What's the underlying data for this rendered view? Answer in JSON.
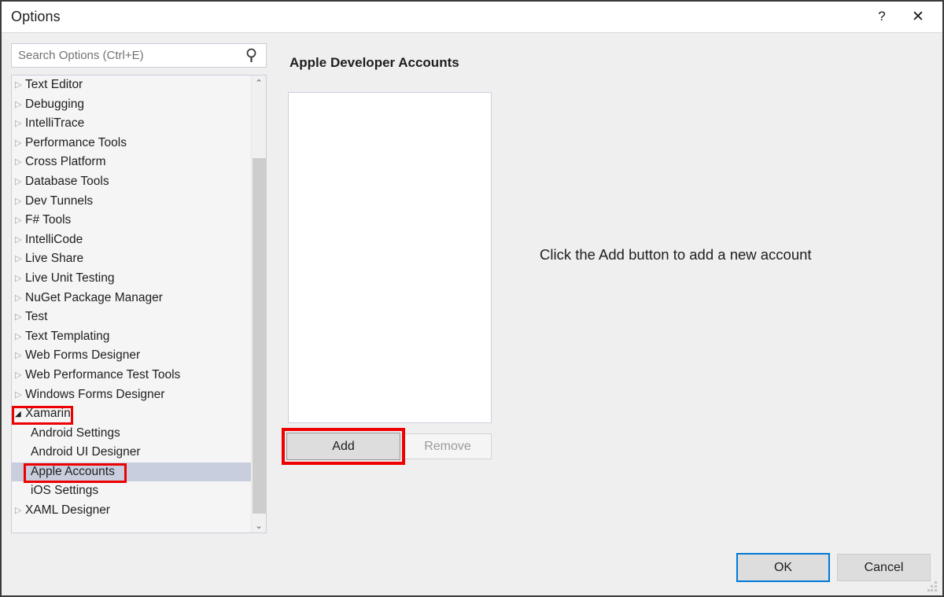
{
  "window": {
    "title": "Options",
    "help_label": "?",
    "close_label": "✕"
  },
  "search": {
    "placeholder": "Search Options (Ctrl+E)",
    "value": "",
    "icon": "search-icon"
  },
  "tree": {
    "items": [
      {
        "label": "Text Editor",
        "state": "collapsed",
        "level": 0,
        "selected": false
      },
      {
        "label": "Debugging",
        "state": "collapsed",
        "level": 0,
        "selected": false
      },
      {
        "label": "IntelliTrace",
        "state": "collapsed",
        "level": 0,
        "selected": false
      },
      {
        "label": "Performance Tools",
        "state": "collapsed",
        "level": 0,
        "selected": false
      },
      {
        "label": "Cross Platform",
        "state": "collapsed",
        "level": 0,
        "selected": false
      },
      {
        "label": "Database Tools",
        "state": "collapsed",
        "level": 0,
        "selected": false
      },
      {
        "label": "Dev Tunnels",
        "state": "collapsed",
        "level": 0,
        "selected": false
      },
      {
        "label": "F# Tools",
        "state": "collapsed",
        "level": 0,
        "selected": false
      },
      {
        "label": "IntelliCode",
        "state": "collapsed",
        "level": 0,
        "selected": false
      },
      {
        "label": "Live Share",
        "state": "collapsed",
        "level": 0,
        "selected": false
      },
      {
        "label": "Live Unit Testing",
        "state": "collapsed",
        "level": 0,
        "selected": false
      },
      {
        "label": "NuGet Package Manager",
        "state": "collapsed",
        "level": 0,
        "selected": false
      },
      {
        "label": "Test",
        "state": "collapsed",
        "level": 0,
        "selected": false
      },
      {
        "label": "Text Templating",
        "state": "collapsed",
        "level": 0,
        "selected": false
      },
      {
        "label": "Web Forms Designer",
        "state": "collapsed",
        "level": 0,
        "selected": false
      },
      {
        "label": "Web Performance Test Tools",
        "state": "collapsed",
        "level": 0,
        "selected": false
      },
      {
        "label": "Windows Forms Designer",
        "state": "collapsed",
        "level": 0,
        "selected": false
      },
      {
        "label": "Xamarin",
        "state": "expanded",
        "level": 0,
        "selected": false
      },
      {
        "label": "Android Settings",
        "state": "leaf",
        "level": 1,
        "selected": false
      },
      {
        "label": "Android UI Designer",
        "state": "leaf",
        "level": 1,
        "selected": false
      },
      {
        "label": "Apple Accounts",
        "state": "leaf",
        "level": 1,
        "selected": true
      },
      {
        "label": "iOS Settings",
        "state": "leaf",
        "level": 1,
        "selected": false
      },
      {
        "label": "XAML Designer",
        "state": "collapsed",
        "level": 0,
        "selected": false
      }
    ],
    "collapsed_glyph": "▷",
    "expanded_glyph": "◢",
    "scroll_up_glyph": "⌃",
    "scroll_down_glyph": "⌄"
  },
  "panel": {
    "title": "Apple Developer Accounts",
    "empty_message": "Click the Add button to add a new account",
    "accounts": [],
    "add_label": "Add",
    "remove_label": "Remove",
    "remove_disabled": true
  },
  "footer": {
    "ok_label": "OK",
    "cancel_label": "Cancel"
  },
  "annotations": {
    "color": "#ee0000",
    "targets": [
      "Xamarin",
      "Apple Accounts",
      "Add"
    ]
  }
}
